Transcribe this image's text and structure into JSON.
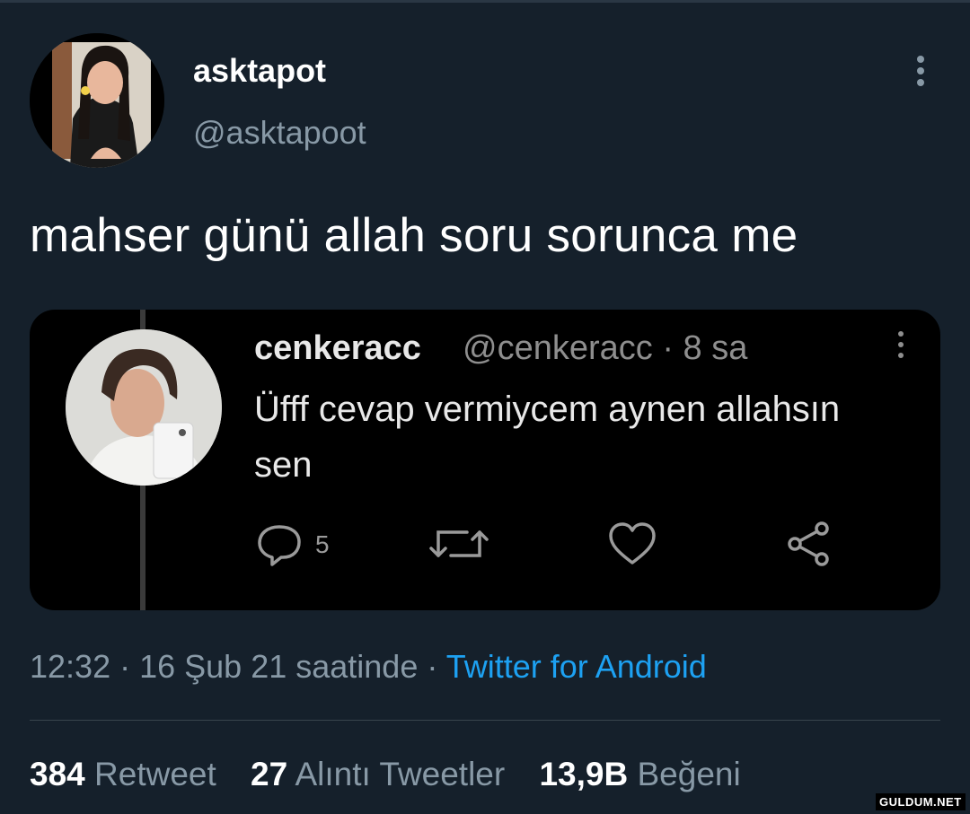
{
  "tweet": {
    "display_name": "asktapot",
    "handle": "@asktapoot",
    "text": "mahser günü allah soru sorunca me",
    "time": "12:32",
    "date": "16 Şub 21 saatinde",
    "source": "Twitter for Android",
    "stats": {
      "retweets_count": "384",
      "retweets_label": "Retweet",
      "quotes_count": "27",
      "quotes_label": "Alıntı Tweetler",
      "likes_count": "13,9B",
      "likes_label": "Beğeni"
    }
  },
  "embedded_tweet": {
    "name": "cenkeracc",
    "handle": "@cenkeracc",
    "age": "8 sa",
    "text": "Üfff cevap vermiycem aynen allahsın sen",
    "reply_count": "5"
  },
  "watermark": "GULDUM.NET",
  "colors": {
    "background": "#15202b",
    "accent": "#1da1f2",
    "secondary_text": "#8899a6"
  },
  "icons": {
    "more": "more-vertical-icon",
    "reply": "reply-icon",
    "retweet": "retweet-icon",
    "like": "heart-icon",
    "share": "share-icon"
  }
}
